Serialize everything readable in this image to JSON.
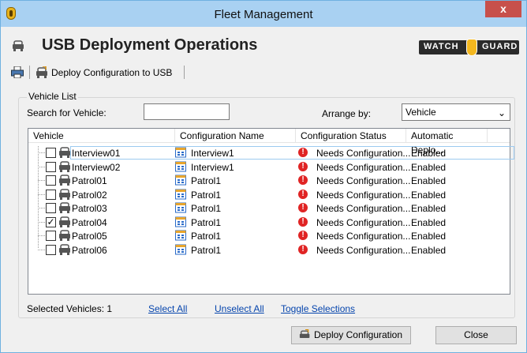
{
  "window": {
    "title": "Fleet Management",
    "close_glyph": "x",
    "title_bar_color": "#a9d1f2",
    "close_color": "#c7504b"
  },
  "header": {
    "title": "USB Deployment Operations",
    "icon": "vehicle-icon",
    "logo_left": "WATCH",
    "logo_right": "GUARD"
  },
  "toolbar": {
    "print_icon": "printer-icon",
    "deploy_label": "Deploy Configuration to USB",
    "deploy_icon": "usb-deploy-icon"
  },
  "vehicle_list": {
    "group_title": "Vehicle List",
    "search_label": "Search for Vehicle:",
    "search_value": "",
    "arrange_label": "Arrange by:",
    "arrange_value": "Vehicle",
    "columns": [
      "Vehicle",
      "Configuration Name",
      "Configuration Status",
      "Automatic Deplo..."
    ],
    "rows": [
      {
        "vehicle": "Interview01",
        "checked": false,
        "config": "Interview1",
        "status": "Needs Configuration...",
        "auto": "Enabled",
        "focused": true
      },
      {
        "vehicle": "Interview02",
        "checked": false,
        "config": "Interview1",
        "status": "Needs Configuration...",
        "auto": "Enabled",
        "focused": false
      },
      {
        "vehicle": "Patrol01",
        "checked": false,
        "config": "Patrol1",
        "status": "Needs Configuration...",
        "auto": "Enabled",
        "focused": false
      },
      {
        "vehicle": "Patrol02",
        "checked": false,
        "config": "Patrol1",
        "status": "Needs Configuration...",
        "auto": "Enabled",
        "focused": false
      },
      {
        "vehicle": "Patrol03",
        "checked": false,
        "config": "Patrol1",
        "status": "Needs Configuration...",
        "auto": "Enabled",
        "focused": false
      },
      {
        "vehicle": "Patrol04",
        "checked": true,
        "config": "Patrol1",
        "status": "Needs Configuration...",
        "auto": "Enabled",
        "focused": false
      },
      {
        "vehicle": "Patrol05",
        "checked": false,
        "config": "Patrol1",
        "status": "Needs Configuration...",
        "auto": "Enabled",
        "focused": false
      },
      {
        "vehicle": "Patrol06",
        "checked": false,
        "config": "Patrol1",
        "status": "Needs Configuration...",
        "auto": "Enabled",
        "focused": false
      }
    ],
    "selected_text": "Selected Vehicles: 1",
    "select_all": "Select All",
    "unselect_all": "Unselect All",
    "toggle": "Toggle Selections"
  },
  "buttons": {
    "deploy": "Deploy Configuration",
    "close": "Close"
  }
}
